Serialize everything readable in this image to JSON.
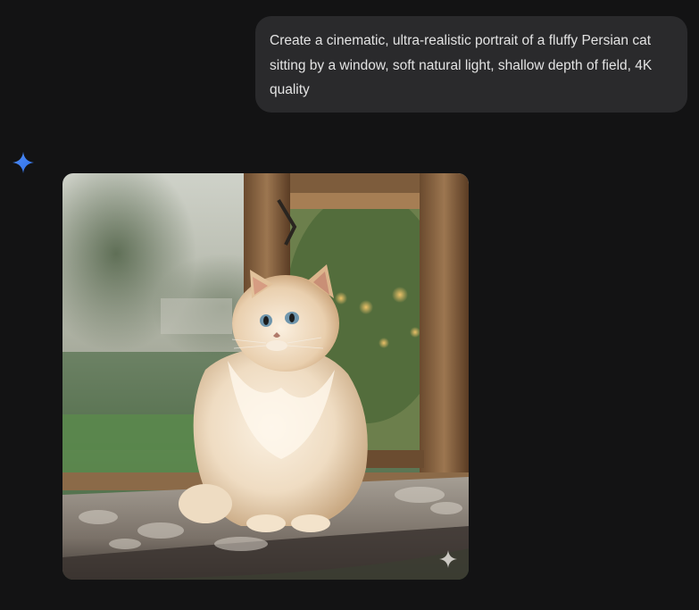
{
  "user_message": {
    "text": "Create a cinematic, ultra-realistic portrait of a fluffy Persian cat sitting by a window, soft natural light, shallow depth of field, 4K quality"
  },
  "assistant": {
    "icon": "gemini-sparkle-icon",
    "image": {
      "subject": "fluffy cream Persian cat sitting on a patterned window seat cushion beside a wooden-framed window with blurred green garden behind",
      "watermark_icon": "sparkle-watermark-icon"
    }
  },
  "colors": {
    "background": "#131314",
    "bubble": "#2a2a2c",
    "text": "#e3e3e3",
    "accent_blue": "#4f8df7"
  }
}
